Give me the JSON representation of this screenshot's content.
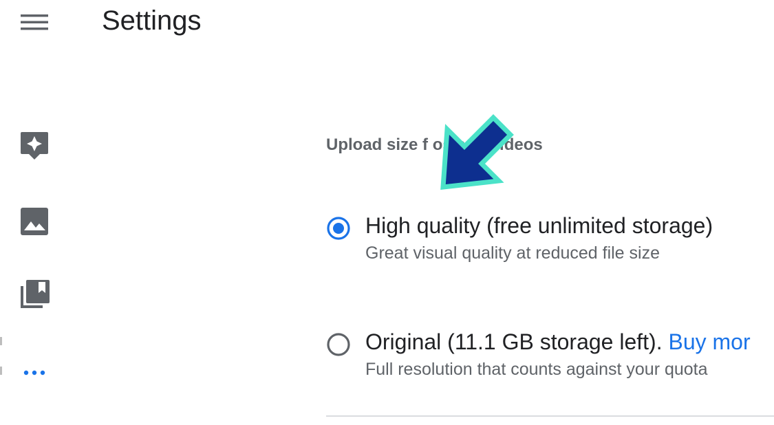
{
  "header": {
    "title": "Settings",
    "menu_icon": "hamburger-menu-icon"
  },
  "sidebar": {
    "items": [
      {
        "icon": "assistant-icon"
      },
      {
        "icon": "photos-icon"
      },
      {
        "icon": "albums-icon"
      },
      {
        "icon": "more-icon"
      }
    ]
  },
  "upload_size": {
    "title": "Upload size f        os and videos",
    "options": [
      {
        "label": "High quality (free unlimited storage)",
        "description": "Great visual quality at reduced file size",
        "selected": true
      },
      {
        "label": "Original (11.1 GB storage left).",
        "link": "Buy mor",
        "description": "Full resolution that counts against your quota",
        "selected": false
      }
    ]
  },
  "colors": {
    "accent": "#1a73e8",
    "icon": "#5f6368",
    "arrow_fill": "#0d2f8f",
    "arrow_outline": "#4be2c8"
  }
}
